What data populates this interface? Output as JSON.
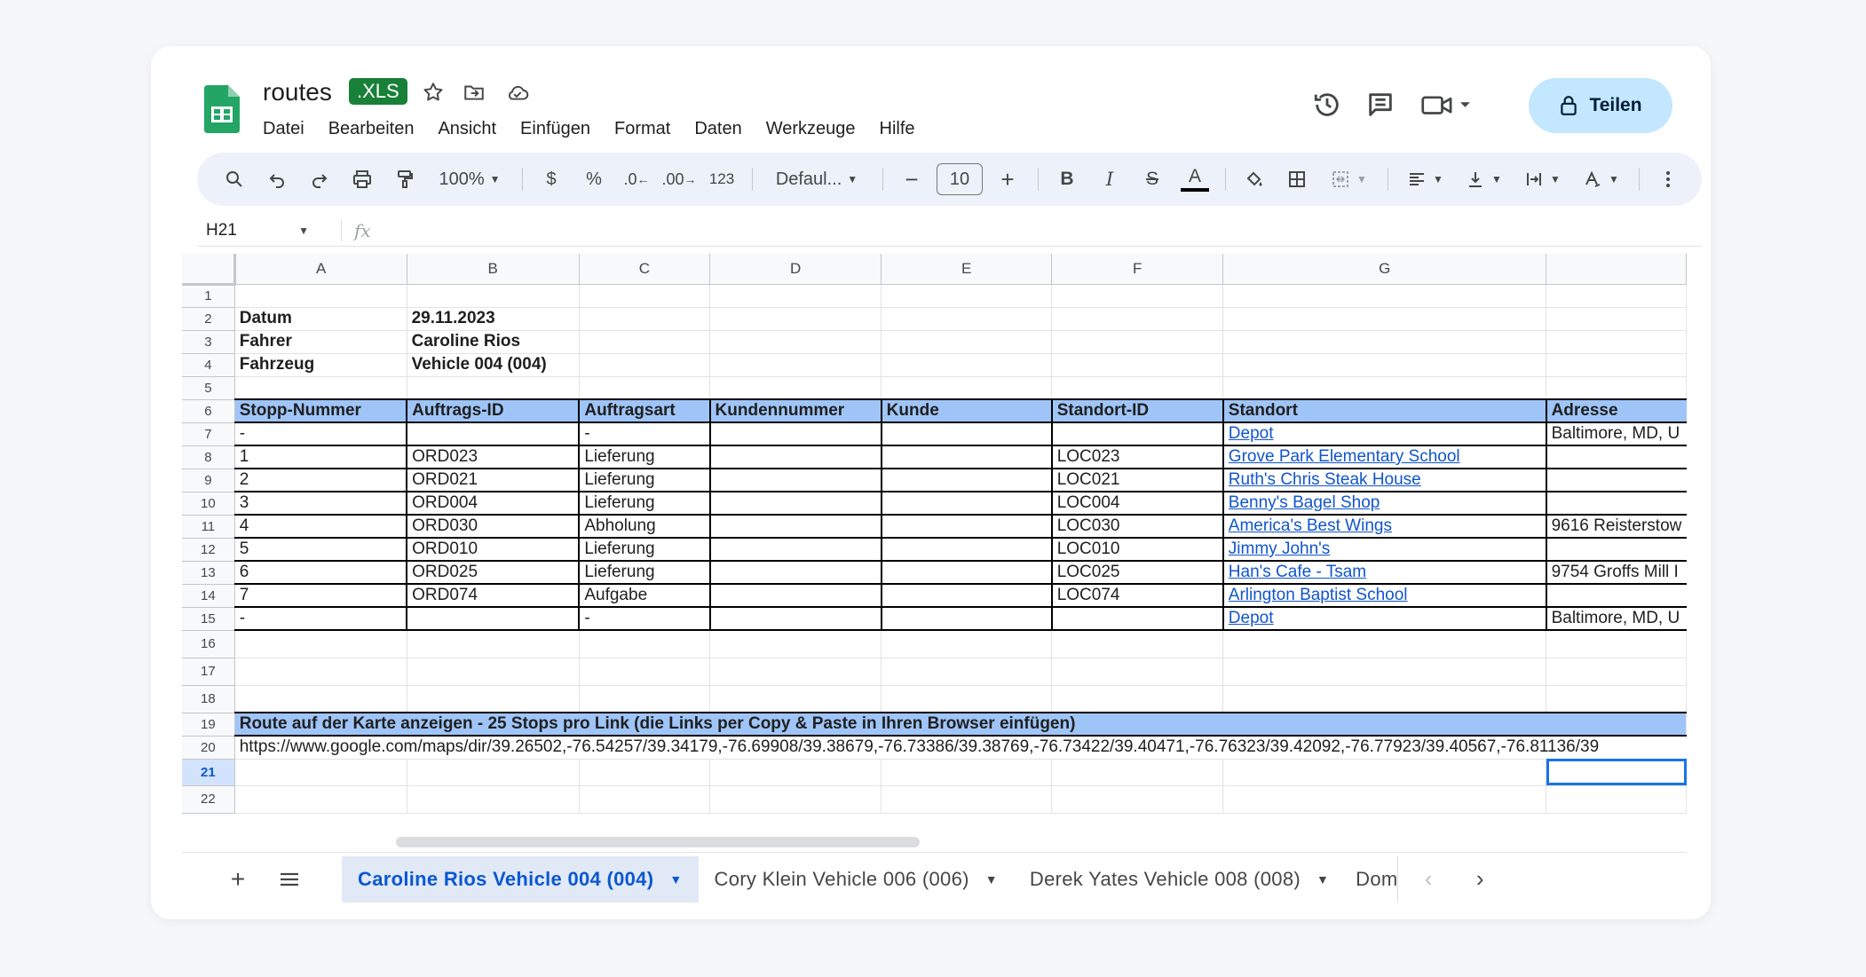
{
  "doc": {
    "title": "routes",
    "format_badge": ".XLS",
    "share_label": "Teilen"
  },
  "menu": [
    "Datei",
    "Bearbeiten",
    "Ansicht",
    "Einfügen",
    "Format",
    "Daten",
    "Werkzeuge",
    "Hilfe"
  ],
  "toolbar": {
    "zoom": "100%",
    "currency": "$",
    "percent": "%",
    "decrease_decimal": ".0",
    "increase_decimal": ".00",
    "number_format": "123",
    "font": "Defaul...",
    "font_size": "10",
    "bold": "B",
    "italic": "I",
    "strike": "S",
    "text_color": "A",
    "minus": "−",
    "plus": "+"
  },
  "formula_bar": {
    "cell_ref": "H21",
    "fx": "fx",
    "value": ""
  },
  "columns": [
    "A",
    "B",
    "C",
    "D",
    "E",
    "F",
    "G",
    ""
  ],
  "rows": {
    "r2": [
      "Datum",
      "29.11.2023"
    ],
    "r3": [
      "Fahrer",
      "Caroline Rios"
    ],
    "r4": [
      "Fahrzeug",
      "Vehicle 004 (004)"
    ],
    "header": [
      "Stopp-Nummer",
      "Auftrags-ID",
      "Auftragsart",
      "Kundennummer",
      "Kunde",
      "Standort-ID",
      "Standort",
      "Adresse"
    ],
    "stops": [
      [
        "-",
        "",
        "-",
        "",
        "",
        "",
        "Depot",
        "Baltimore, MD, U"
      ],
      [
        "1",
        "ORD023",
        "Lieferung",
        "",
        "",
        "LOC023",
        "Grove Park Elementary School",
        ""
      ],
      [
        "2",
        "ORD021",
        "Lieferung",
        "",
        "",
        "LOC021",
        "Ruth's Chris Steak House",
        ""
      ],
      [
        "3",
        "ORD004",
        "Lieferung",
        "",
        "",
        "LOC004",
        "Benny's Bagel Shop",
        ""
      ],
      [
        "4",
        "ORD030",
        "Abholung",
        "",
        "",
        "LOC030",
        "America's Best Wings",
        "9616 Reisterstow"
      ],
      [
        "5",
        "ORD010",
        "Lieferung",
        "",
        "",
        "LOC010",
        "Jimmy John's",
        ""
      ],
      [
        "6",
        "ORD025",
        "Lieferung",
        "",
        "",
        "LOC025",
        "Han's Cafe - Tsam",
        "9754 Groffs Mill I"
      ],
      [
        "7",
        "ORD074",
        "Aufgabe",
        "",
        "",
        "LOC074",
        "Arlington Baptist School",
        ""
      ],
      [
        "-",
        "",
        "-",
        "",
        "",
        "",
        "Depot",
        "Baltimore, MD, U"
      ]
    ],
    "r19": "Route auf der Karte anzeigen - 25 Stops pro Link (die Links per Copy & Paste in Ihren Browser einfügen)",
    "r20": "https://www.google.com/maps/dir/39.26502,-76.54257/39.34179,-76.69908/39.38679,-76.73386/39.38769,-76.73422/39.40471,-76.76323/39.42092,-76.77923/39.40567,-76.81136/39"
  },
  "sheet_tabs": [
    "Caroline Rios Vehicle 004 (004)",
    "Cory Klein Vehicle 006 (006)",
    "Derek Yates Vehicle 008 (008)",
    "Domi"
  ],
  "colors": {
    "header_fill": "#9fc5f8",
    "link": "#1155cc",
    "share_bg": "#c2e7ff",
    "badge": "#188038",
    "active_tab": "#0b57d0"
  }
}
